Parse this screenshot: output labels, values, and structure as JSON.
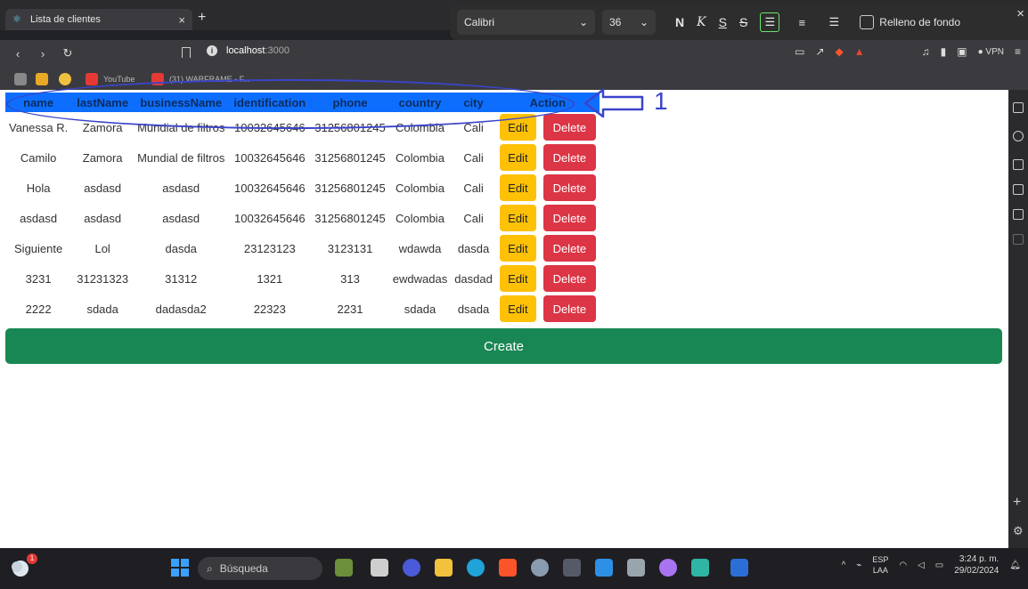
{
  "browser": {
    "tab_title": "Lista de clientes",
    "tab_close": "×",
    "new_tab": "+",
    "url_host": "localhost",
    "url_port": ":3000",
    "vpn_label": "VPN"
  },
  "format_toolbar": {
    "font": "Calibri",
    "size": "36",
    "bold": "N",
    "italic": "K",
    "underline": "S",
    "strike": "S",
    "fill_label": "Relleno de fondo"
  },
  "bookmarks": {
    "youtube": "YouTube",
    "warframe": "(31) WARFRAME - F..."
  },
  "table": {
    "headers": [
      "name",
      "lastName",
      "businessName",
      "identification",
      "phone",
      "country",
      "city",
      "Action"
    ],
    "rows": [
      [
        "Vanessa R.",
        "Zamora",
        "Mundial de filtros",
        "10032645646",
        "31256801245",
        "Colombia",
        "Cali"
      ],
      [
        "Camilo",
        "Zamora",
        "Mundial de filtros",
        "10032645646",
        "31256801245",
        "Colombia",
        "Cali"
      ],
      [
        "Hola",
        "asdasd",
        "asdasd",
        "10032645646",
        "31256801245",
        "Colombia",
        "Cali"
      ],
      [
        "asdasd",
        "asdasd",
        "asdasd",
        "10032645646",
        "31256801245",
        "Colombia",
        "Cali"
      ],
      [
        "Siguiente",
        "Lol",
        "dasda",
        "23123123",
        "3123131",
        "wdawda",
        "dasda"
      ],
      [
        "3231",
        "31231323",
        "31312",
        "1321",
        "313",
        "ewdwadas",
        "dasdad"
      ],
      [
        "2222",
        "sdada",
        "dadasda2",
        "22323",
        "2231",
        "sdada",
        "dsada"
      ]
    ],
    "edit_label": "Edit",
    "delete_label": "Delete"
  },
  "create_label": "Create",
  "annotation_number": "1",
  "taskbar": {
    "search_placeholder": "Búsqueda",
    "weather_badge": "1",
    "lang_top": "ESP",
    "lang_bottom": "LAA",
    "time": "3:24 p. m.",
    "date": "29/02/2024"
  },
  "colors": {
    "header_blue": "#0d6efd",
    "edit_yellow": "#ffc107",
    "delete_red": "#dc3545",
    "create_green": "#198754",
    "annotation": "#3b44c9"
  }
}
